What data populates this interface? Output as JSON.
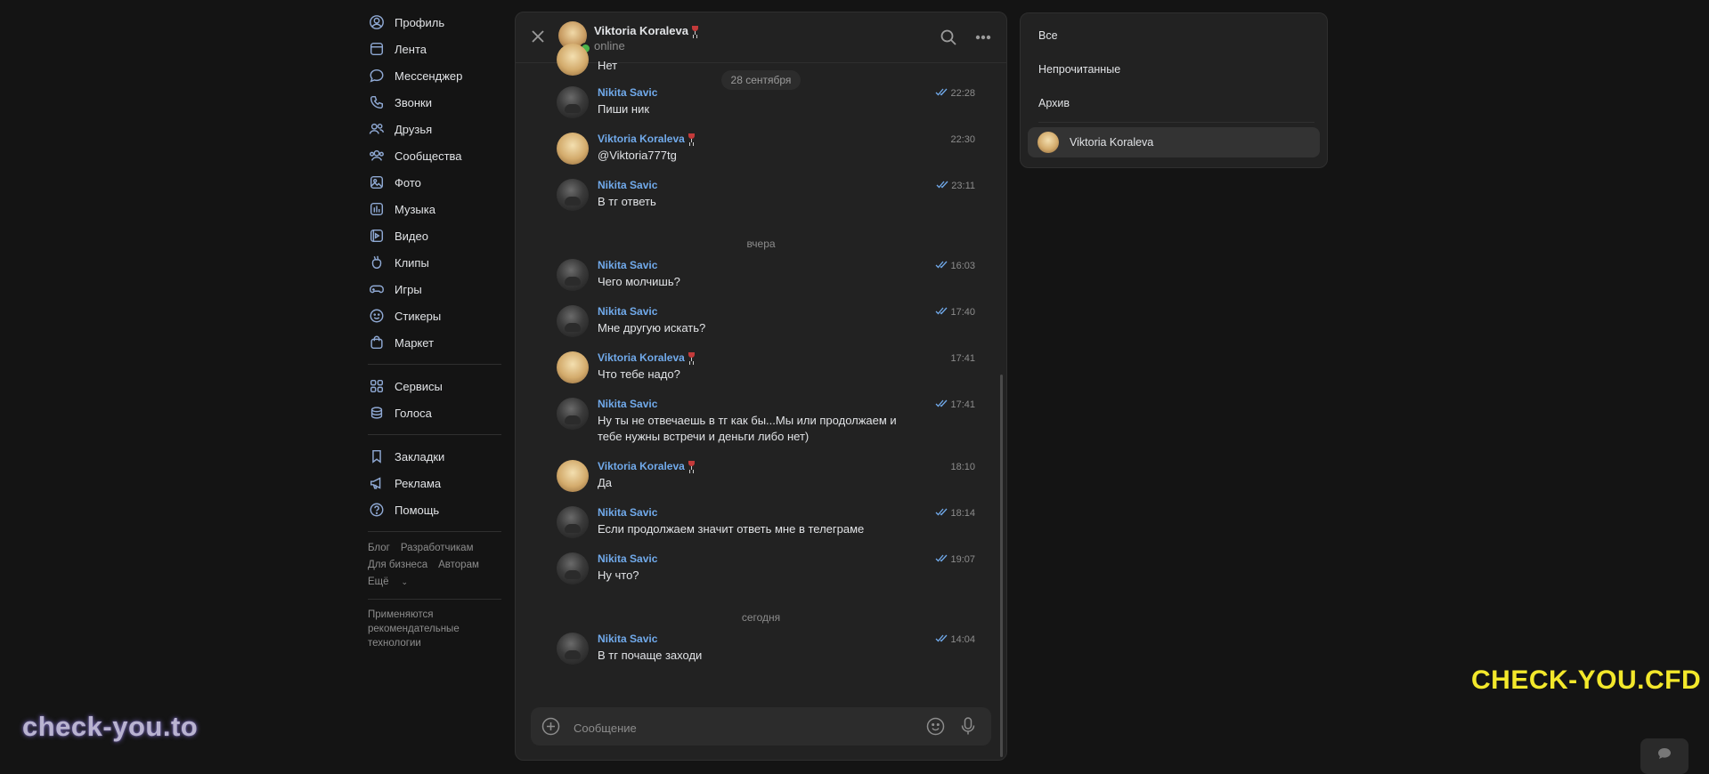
{
  "sidebar": {
    "items": [
      {
        "label": "Профиль",
        "icon": "user-icon"
      },
      {
        "label": "Лента",
        "icon": "feed-icon"
      },
      {
        "label": "Мессенджер",
        "icon": "message-icon"
      },
      {
        "label": "Звонки",
        "icon": "phone-icon"
      },
      {
        "label": "Друзья",
        "icon": "friends-icon"
      },
      {
        "label": "Сообщества",
        "icon": "communities-icon"
      },
      {
        "label": "Фото",
        "icon": "photo-icon"
      },
      {
        "label": "Музыка",
        "icon": "music-icon"
      },
      {
        "label": "Видео",
        "icon": "video-icon"
      },
      {
        "label": "Клипы",
        "icon": "clips-icon"
      },
      {
        "label": "Игры",
        "icon": "gamepad-icon"
      },
      {
        "label": "Стикеры",
        "icon": "sticker-icon"
      },
      {
        "label": "Маркет",
        "icon": "market-icon"
      }
    ],
    "items2": [
      {
        "label": "Сервисы",
        "icon": "services-icon"
      },
      {
        "label": "Голоса",
        "icon": "coins-icon"
      }
    ],
    "items3": [
      {
        "label": "Закладки",
        "icon": "bookmark-icon"
      },
      {
        "label": "Реклама",
        "icon": "megaphone-icon"
      },
      {
        "label": "Помощь",
        "icon": "help-icon"
      }
    ],
    "footer": {
      "blog": "Блог",
      "developers": "Разработчикам",
      "business": "Для бизнеса",
      "authors": "Авторам",
      "more": "Ещё"
    },
    "reco_note": "Применяются рекомендательные технологии"
  },
  "chat": {
    "contact_name": "Viktoria Koraleva",
    "status": "online",
    "partial_top_text": "Нет",
    "date_labels": [
      "28 сентября",
      "вчера",
      "сегодня"
    ],
    "messages": [
      {
        "author": "Nikita Savic",
        "time": "22:28",
        "text": "Пиши ник",
        "read": true
      },
      {
        "author": "Viktoria Koraleva",
        "time": "22:30",
        "text": "@Viktoria777tg",
        "read": false
      },
      {
        "author": "Nikita Savic",
        "time": "23:11",
        "text": "В тг ответь",
        "read": true
      },
      {
        "author": "Nikita Savic",
        "time": "16:03",
        "text": "Чего молчишь?",
        "read": true
      },
      {
        "author": "Nikita Savic",
        "time": "17:40",
        "text": "Мне другую искать?",
        "read": true
      },
      {
        "author": "Viktoria Koraleva",
        "time": "17:41",
        "text": "Что тебе надо?",
        "read": false
      },
      {
        "author": "Nikita Savic",
        "time": "17:41",
        "text": "Ну ты не отвечаешь в тг как бы...Мы или продолжаем и тебе нужны встречи и деньги либо нет)",
        "read": true
      },
      {
        "author": "Viktoria Koraleva",
        "time": "18:10",
        "text": "Да",
        "read": false
      },
      {
        "author": "Nikita Savic",
        "time": "18:14",
        "text": "Если продолжаем значит ответь мне в телеграме",
        "read": true
      },
      {
        "author": "Nikita Savic",
        "time": "19:07",
        "text": "Ну что?",
        "read": true
      },
      {
        "author": "Nikita Savic",
        "time": "14:04",
        "text": "В тг почаще заходи",
        "read": true
      }
    ],
    "composer_placeholder": "Сообщение"
  },
  "filters": {
    "all": "Все",
    "unread": "Непрочитанные",
    "archive": "Архив",
    "folder_chat": "Viktoria Koraleva"
  },
  "watermarks": {
    "left": "check-you.to",
    "right": "CHECK-YOU.CFD"
  },
  "colors": {
    "background": "#141414",
    "panel": "#222222",
    "accent_link": "#71aaeb",
    "icon": "#8fa9d4",
    "watermark_yellow": "#f3e82b"
  }
}
